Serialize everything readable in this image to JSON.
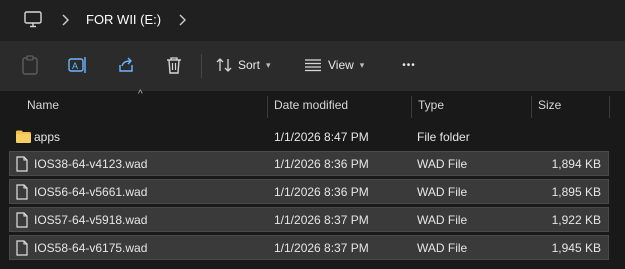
{
  "address": {
    "crumb": "FOR WII (E:)"
  },
  "toolbar": {
    "sort_label": "Sort",
    "view_label": "View",
    "more_label": "•••"
  },
  "columns": {
    "name": "Name",
    "date": "Date modified",
    "type": "Type",
    "size": "Size"
  },
  "rows": [
    {
      "name": "apps",
      "date": "1/1/2026 8:47 PM",
      "type": "File folder",
      "size": ""
    },
    {
      "name": "IOS38-64-v4123.wad",
      "date": "1/1/2026 8:36 PM",
      "type": "WAD File",
      "size": "1,894 KB"
    },
    {
      "name": "IOS56-64-v5661.wad",
      "date": "1/1/2026 8:36 PM",
      "type": "WAD File",
      "size": "1,895 KB"
    },
    {
      "name": "IOS57-64-v5918.wad",
      "date": "1/1/2026 8:37 PM",
      "type": "WAD File",
      "size": "1,922 KB"
    },
    {
      "name": "IOS58-64-v6175.wad",
      "date": "1/1/2026 8:37 PM",
      "type": "WAD File",
      "size": "1,945 KB"
    }
  ],
  "colors": {
    "background": "#191919",
    "selected_row": "#3a3a3a",
    "folder": "#f2c14e",
    "accent_icon": "#6cb6ff"
  }
}
